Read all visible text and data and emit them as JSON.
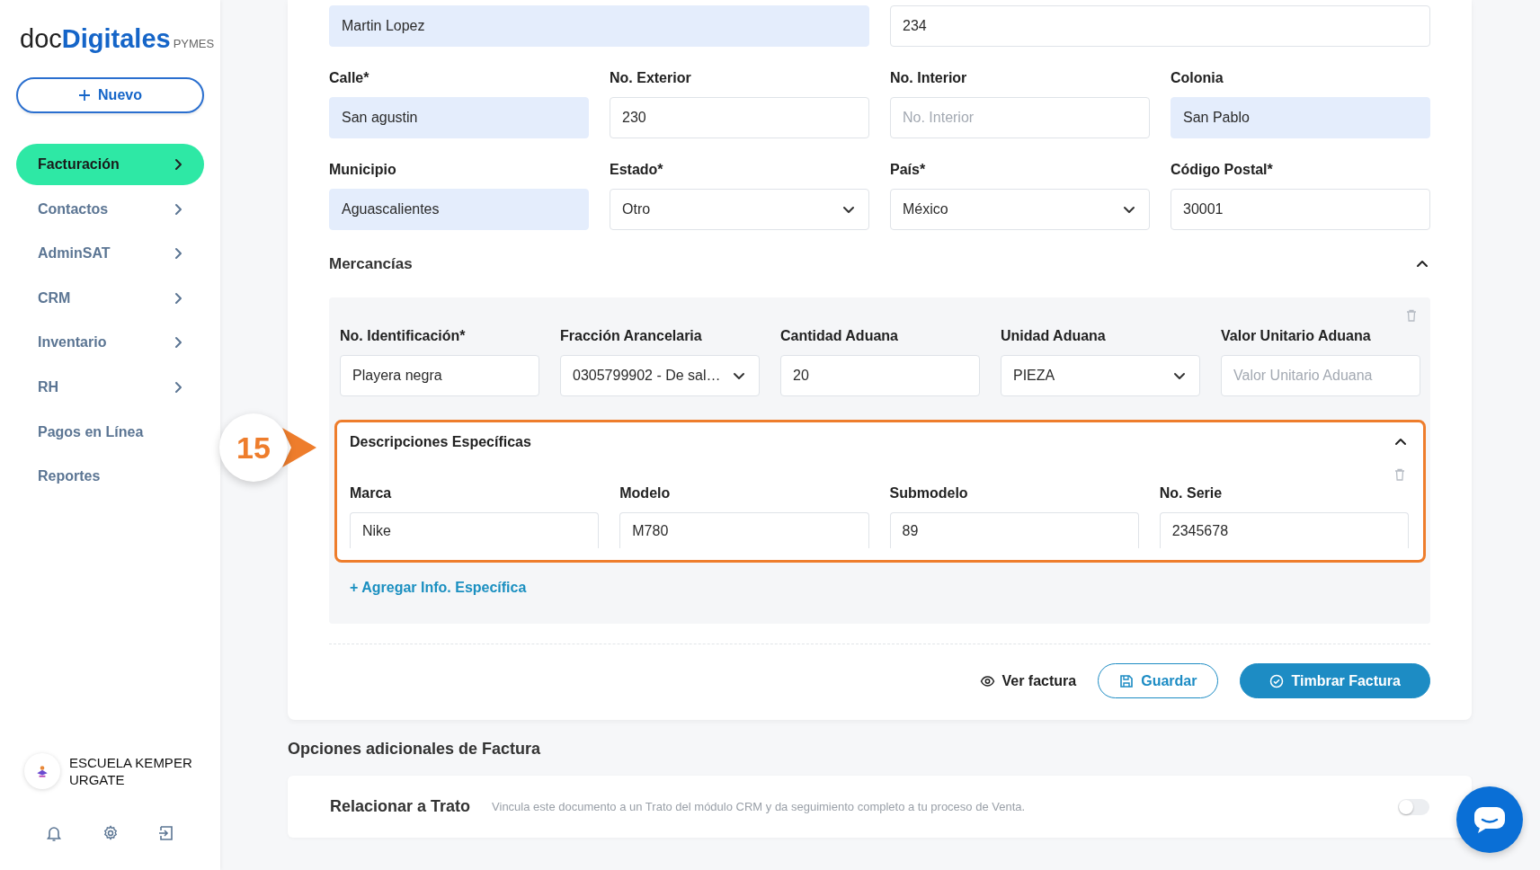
{
  "sidebar": {
    "logo": {
      "prefix": "doc",
      "brand": "Digitales",
      "suffix": "PYMES"
    },
    "new_button": "Nuevo",
    "items": [
      {
        "label": "Facturación",
        "selected": true,
        "has_submenu": true
      },
      {
        "label": "Contactos",
        "selected": false,
        "has_submenu": true
      },
      {
        "label": "AdminSAT",
        "selected": false,
        "has_submenu": true
      },
      {
        "label": "CRM",
        "selected": false,
        "has_submenu": true
      },
      {
        "label": "Inventario",
        "selected": false,
        "has_submenu": true
      },
      {
        "label": "RH",
        "selected": false,
        "has_submenu": true
      },
      {
        "label": "Pagos en Línea",
        "selected": false,
        "has_submenu": false
      },
      {
        "label": "Reportes",
        "selected": false,
        "has_submenu": false
      }
    ],
    "account": {
      "name": "ESCUELA KEMPER URGATE"
    }
  },
  "invoice_form": {
    "top_fields": [
      {
        "kind": "text",
        "value": "Martin Lopez",
        "highlighted": true
      },
      {
        "kind": "text",
        "value": "234",
        "highlighted": false
      }
    ],
    "address_fields": [
      {
        "label": "Calle*",
        "kind": "text",
        "value": "San agustin",
        "highlighted": true
      },
      {
        "label": "No. Exterior",
        "kind": "text",
        "value": "230",
        "highlighted": false
      },
      {
        "label": "No. Interior",
        "kind": "text",
        "placeholder": "No. Interior",
        "highlighted": false
      },
      {
        "label": "Colonia",
        "kind": "text",
        "value": "San Pablo",
        "highlighted": true
      },
      {
        "label": "Municipio",
        "kind": "text",
        "value": "Aguascalientes",
        "highlighted": true
      },
      {
        "label": "Estado*",
        "kind": "select",
        "value": "Otro",
        "highlighted": false
      },
      {
        "label": "País*",
        "kind": "select",
        "value": "México",
        "highlighted": false
      },
      {
        "label": "Código Postal*",
        "kind": "text",
        "value": "30001",
        "highlighted": false
      }
    ],
    "mercancias": {
      "title": "Mercancías",
      "expanded": true,
      "fields": [
        {
          "label": "No. Identificación*",
          "kind": "text",
          "value": "Playera negra",
          "highlighted": false
        },
        {
          "label": "Fracción Arancelaria",
          "kind": "select",
          "value": "0305799902 - De sal…",
          "highlighted": false
        },
        {
          "label": "Cantidad Aduana",
          "kind": "text",
          "value": "20",
          "highlighted": false
        },
        {
          "label": "Unidad Aduana",
          "kind": "select",
          "value": "PIEZA",
          "highlighted": false
        },
        {
          "label": "Valor Unitario Aduana",
          "kind": "text",
          "placeholder": "Valor Unitario Aduana",
          "highlighted": false
        }
      ],
      "descripciones": {
        "title": "Descripciones Específicas",
        "expanded": true,
        "fields": [
          {
            "label": "Marca",
            "kind": "text",
            "value": "Nike",
            "highlighted": false
          },
          {
            "label": "Modelo",
            "kind": "text",
            "value": "M780",
            "highlighted": false
          },
          {
            "label": "Submodelo",
            "kind": "text",
            "value": "89",
            "highlighted": false
          },
          {
            "label": "No. Serie",
            "kind": "text",
            "value": "2345678",
            "highlighted": false
          }
        ]
      },
      "add_link": "+ Agregar Info. Específica"
    },
    "actions": [
      {
        "kind": "link",
        "label": "Ver factura"
      },
      {
        "kind": "outline",
        "label": "Guardar"
      },
      {
        "kind": "primary",
        "label": "Timbrar Factura"
      }
    ]
  },
  "additional_options": {
    "title": "Opciones adicionales de Factura",
    "rows": [
      {
        "title": "Relacionar a Trato",
        "description": "Vincula este documento a un Trato del módulo CRM y da seguimiento completo a tu proceso de Venta.",
        "on": false
      }
    ]
  },
  "callout": {
    "number": "15"
  }
}
